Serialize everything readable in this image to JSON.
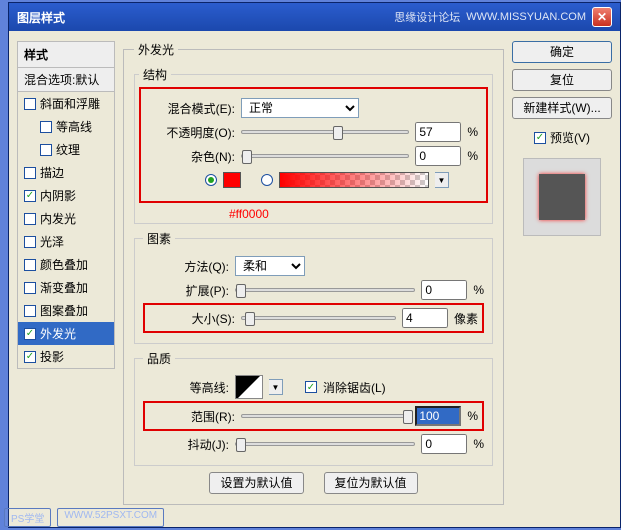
{
  "window": {
    "title": "图层样式",
    "watermark": "思缘设计论坛",
    "watermark_url": "WWW.MISSYUAN.COM"
  },
  "sidebar": {
    "header": "样式",
    "sub": "混合选项:默认",
    "items": [
      {
        "label": "斜面和浮雕",
        "checked": false,
        "indent": false
      },
      {
        "label": "等高线",
        "checked": false,
        "indent": true
      },
      {
        "label": "纹理",
        "checked": false,
        "indent": true
      },
      {
        "label": "描边",
        "checked": false,
        "indent": false
      },
      {
        "label": "内阴影",
        "checked": true,
        "indent": false
      },
      {
        "label": "内发光",
        "checked": false,
        "indent": false
      },
      {
        "label": "光泽",
        "checked": false,
        "indent": false
      },
      {
        "label": "颜色叠加",
        "checked": false,
        "indent": false
      },
      {
        "label": "渐变叠加",
        "checked": false,
        "indent": false
      },
      {
        "label": "图案叠加",
        "checked": false,
        "indent": false
      },
      {
        "label": "外发光",
        "checked": true,
        "indent": false,
        "selected": true
      },
      {
        "label": "投影",
        "checked": true,
        "indent": false
      }
    ]
  },
  "center": {
    "group_title": "外发光",
    "structure": {
      "legend": "结构",
      "blend_label": "混合模式(E):",
      "blend_value": "正常",
      "opacity_label": "不透明度(O):",
      "opacity_value": "57",
      "opacity_unit": "%",
      "noise_label": "杂色(N):",
      "noise_value": "0",
      "noise_unit": "%",
      "hex": "#ff0000"
    },
    "elements": {
      "legend": "图素",
      "technique_label": "方法(Q):",
      "technique_value": "柔和",
      "spread_label": "扩展(P):",
      "spread_value": "0",
      "spread_unit": "%",
      "size_label": "大小(S):",
      "size_value": "4",
      "size_unit": "像素"
    },
    "quality": {
      "legend": "品质",
      "contour_label": "等高线:",
      "antialias_label": "消除锯齿(L)",
      "range_label": "范围(R):",
      "range_value": "100",
      "range_unit": "%",
      "jitter_label": "抖动(J):",
      "jitter_value": "0",
      "jitter_unit": "%"
    },
    "buttons": {
      "set_default": "设置为默认值",
      "reset_default": "复位为默认值"
    }
  },
  "right": {
    "ok": "确定",
    "cancel": "复位",
    "new_style": "新建样式(W)...",
    "preview_label": "预览(V)"
  },
  "footer": {
    "wm1": "PS学堂",
    "wm2": "WWW.52PSXT.COM"
  }
}
